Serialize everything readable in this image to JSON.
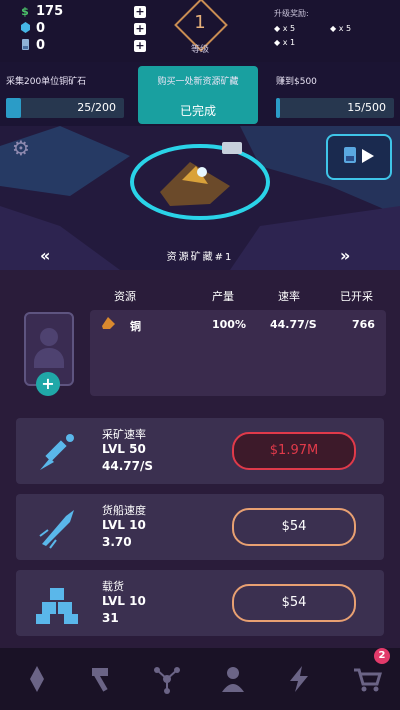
{
  "resources": {
    "money_symbol": "$",
    "money": "175",
    "gems": "0",
    "cards": "0",
    "plus": "+"
  },
  "level": {
    "number": "1",
    "label": "等级"
  },
  "rewards": {
    "title": "升级奖励:",
    "items": [
      "x 5",
      "x 5",
      "x 1"
    ]
  },
  "quests": [
    {
      "title": "采集200单位铜矿石",
      "progress": "25/200",
      "fill": 0.125
    },
    {
      "title": "购买一处新资源矿藏",
      "status": "已完成"
    },
    {
      "title": "赚到$500",
      "progress": "15/500",
      "fill": 0.03
    }
  ],
  "site": {
    "name": "资源矿藏#1",
    "prev": "«",
    "next": "»"
  },
  "table": {
    "headers": [
      "资源",
      "产量",
      "速率",
      "已开采"
    ],
    "row": {
      "name": "铜",
      "yield": "100%",
      "rate": "44.77/S",
      "mined": "766"
    }
  },
  "upgrades": [
    {
      "name": "采矿速率",
      "level": "LVL 50",
      "value": "44.77/S",
      "cost": "$1.97M",
      "affordable": false
    },
    {
      "name": "货船速度",
      "level": "LVL 10",
      "value": "3.70",
      "cost": "$54",
      "affordable": true
    },
    {
      "name": "载货",
      "level": "LVL 10",
      "value": "31",
      "cost": "$54",
      "affordable": true
    }
  ],
  "nav": {
    "badge": "2"
  },
  "colors": {
    "accent": "#19a0a0",
    "cost_locked": "#e03a4a",
    "cost_ok": "#e8a072",
    "money": "#4cc36a"
  }
}
